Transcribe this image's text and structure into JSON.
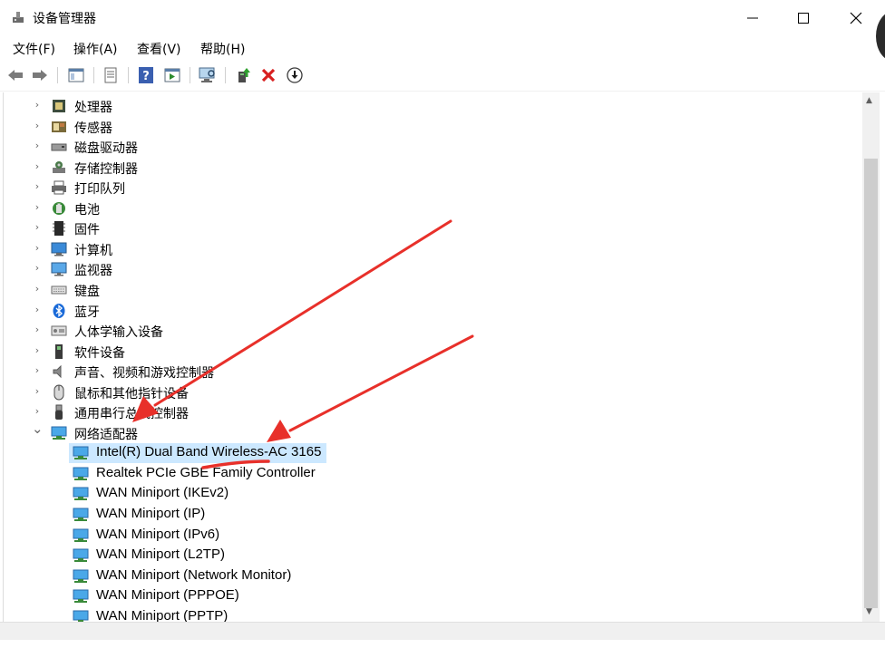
{
  "window": {
    "title": "设备管理器",
    "controls": {
      "minimize": "—",
      "maximize": "☐",
      "close": "✕"
    }
  },
  "menubar": [
    {
      "label": "文件(F)"
    },
    {
      "label": "操作(A)"
    },
    {
      "label": "查看(V)"
    },
    {
      "label": "帮助(H)"
    }
  ],
  "toolbar": [
    {
      "icon": "back-arrow-icon"
    },
    {
      "icon": "forward-arrow-icon"
    },
    {
      "icon": "show-hide-console-tree-icon"
    },
    {
      "icon": "properties-icon"
    },
    {
      "icon": "help-icon"
    },
    {
      "icon": "action-pane-icon"
    },
    {
      "icon": "scan-hardware-icon"
    },
    {
      "icon": "update-driver-icon"
    },
    {
      "icon": "uninstall-device-icon"
    },
    {
      "icon": "disable-device-icon"
    }
  ],
  "tree": {
    "categories": [
      {
        "label": "处理器",
        "icon": "processor-icon",
        "expanded": false
      },
      {
        "label": "传感器",
        "icon": "sensor-icon",
        "expanded": false
      },
      {
        "label": "磁盘驱动器",
        "icon": "disk-drive-icon",
        "expanded": false
      },
      {
        "label": "存储控制器",
        "icon": "storage-controller-icon",
        "expanded": false
      },
      {
        "label": "打印队列",
        "icon": "printer-icon",
        "expanded": false
      },
      {
        "label": "电池",
        "icon": "battery-icon",
        "expanded": false
      },
      {
        "label": "固件",
        "icon": "firmware-icon",
        "expanded": false
      },
      {
        "label": "计算机",
        "icon": "computer-icon",
        "expanded": false
      },
      {
        "label": "监视器",
        "icon": "monitor-icon",
        "expanded": false
      },
      {
        "label": "键盘",
        "icon": "keyboard-icon",
        "expanded": false
      },
      {
        "label": "蓝牙",
        "icon": "bluetooth-icon",
        "expanded": false
      },
      {
        "label": "人体学输入设备",
        "icon": "hid-icon",
        "expanded": false
      },
      {
        "label": "软件设备",
        "icon": "software-device-icon",
        "expanded": false
      },
      {
        "label": "声音、视频和游戏控制器",
        "icon": "audio-icon",
        "expanded": false
      },
      {
        "label": "鼠标和其他指针设备",
        "icon": "mouse-icon",
        "expanded": false
      },
      {
        "label": "通用串行总线控制器",
        "icon": "usb-icon",
        "expanded": false
      },
      {
        "label": "网络适配器",
        "icon": "network-adapter-icon",
        "expanded": true
      }
    ],
    "network_adapters": [
      {
        "label": "Intel(R) Dual Band Wireless-AC 3165",
        "selected": true
      },
      {
        "label": "Realtek PCIe GBE Family Controller",
        "selected": false
      },
      {
        "label": "WAN Miniport (IKEv2)",
        "selected": false
      },
      {
        "label": "WAN Miniport (IP)",
        "selected": false
      },
      {
        "label": "WAN Miniport (IPv6)",
        "selected": false
      },
      {
        "label": "WAN Miniport (L2TP)",
        "selected": false
      },
      {
        "label": "WAN Miniport (Network Monitor)",
        "selected": false
      },
      {
        "label": "WAN Miniport (PPPOE)",
        "selected": false
      },
      {
        "label": "WAN Miniport (PPTP)",
        "selected": false
      }
    ]
  },
  "annotation": {
    "color": "#e8302a",
    "arrows": 2,
    "underline_target": "Wireless-AC"
  }
}
